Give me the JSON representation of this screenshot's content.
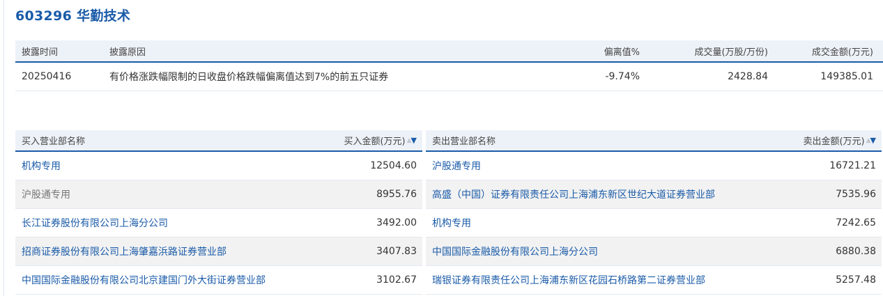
{
  "stock_title": "603296 华勤技术",
  "disclosure": {
    "headers": {
      "date": "披露时间",
      "reason": "披露原因",
      "deviation": "偏离值%",
      "volume": "成交量(万股/万份)",
      "amount": "成交金额(万元)"
    },
    "row": {
      "date": "20250416",
      "reason": "有价格涨跌幅限制的日收盘价格跌幅偏离值达到7%的前五只证券",
      "deviation": "-9.74%",
      "volume": "2428.84",
      "amount": "149385.01"
    }
  },
  "buy_panel": {
    "header_name": "买入营业部名称",
    "header_amount": "买入金额(万元)",
    "rows": [
      {
        "name": "机构专用",
        "amount": "12504.60"
      },
      {
        "name": "沪股通专用",
        "amount": "8955.76"
      },
      {
        "name": "长江证券股份有限公司上海分公司",
        "amount": "3492.00"
      },
      {
        "name": "招商证券股份有限公司上海肇嘉浜路证券营业部",
        "amount": "3407.83"
      },
      {
        "name": "中国国际金融股份有限公司北京建国门外大街证券营业部",
        "amount": "3102.67"
      }
    ]
  },
  "sell_panel": {
    "header_name": "卖出营业部名称",
    "header_amount": "卖出金额(万元)",
    "rows": [
      {
        "name": "沪股通专用",
        "amount": "16721.21"
      },
      {
        "name": "高盛（中国）证券有限责任公司上海浦东新区世纪大道证券营业部",
        "amount": "7535.96"
      },
      {
        "name": "机构专用",
        "amount": "7242.65"
      },
      {
        "name": "中国国际金融股份有限公司上海分公司",
        "amount": "6880.38"
      },
      {
        "name": "瑞银证券有限责任公司上海浦东新区花园石桥路第二证券营业部",
        "amount": "5257.48"
      }
    ]
  },
  "sort_icons": {
    "up": "▲",
    "down": "▼"
  },
  "colors": {
    "accent": "#1a5ba8",
    "header_bg": "#edf2f8",
    "alt_row_bg": "#f2f2f2"
  }
}
